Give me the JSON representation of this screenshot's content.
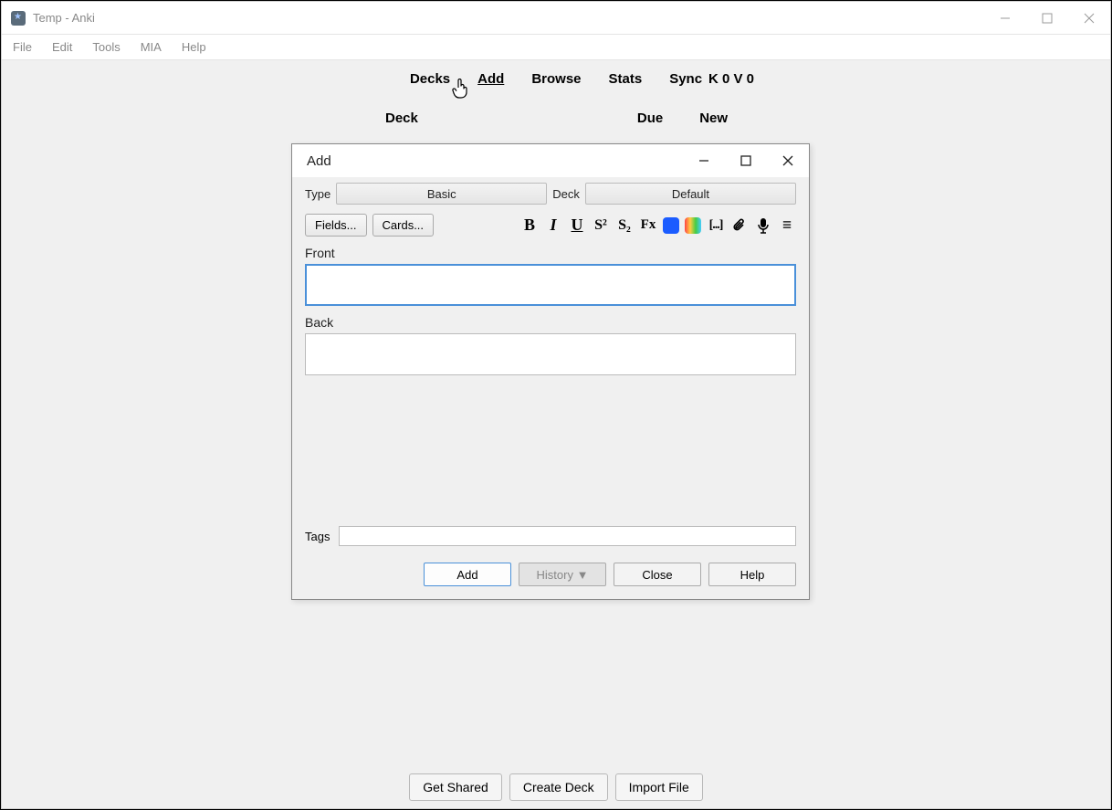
{
  "main": {
    "title": "Temp - Anki",
    "menu": {
      "file": "File",
      "edit": "Edit",
      "tools": "Tools",
      "mia": "MIA",
      "help": "Help"
    },
    "tabs": {
      "decks": "Decks",
      "add": "Add",
      "browse": "Browse",
      "stats": "Stats",
      "sync": "Sync"
    },
    "kv": "K 0 V 0",
    "deck_header": {
      "deck": "Deck",
      "due": "Due",
      "new": "New"
    },
    "bottom": {
      "get_shared": "Get Shared",
      "create_deck": "Create Deck",
      "import_file": "Import File"
    }
  },
  "add_dialog": {
    "title": "Add",
    "type_label": "Type",
    "type_value": "Basic",
    "deck_label": "Deck",
    "deck_value": "Default",
    "fields_btn": "Fields...",
    "cards_btn": "Cards...",
    "front_label": "Front",
    "front_value": "",
    "back_label": "Back",
    "back_value": "",
    "tags_label": "Tags",
    "tags_value": "",
    "buttons": {
      "add": "Add",
      "history": "History ▼",
      "close": "Close",
      "help": "Help"
    },
    "format_icons": {
      "bold": "B",
      "italic": "I",
      "underline": "U",
      "sup": "S²",
      "sub": "S₂",
      "clear": "Fx",
      "cloze": "[...]",
      "attach": "attach",
      "mic": "mic",
      "more": "≡"
    }
  }
}
